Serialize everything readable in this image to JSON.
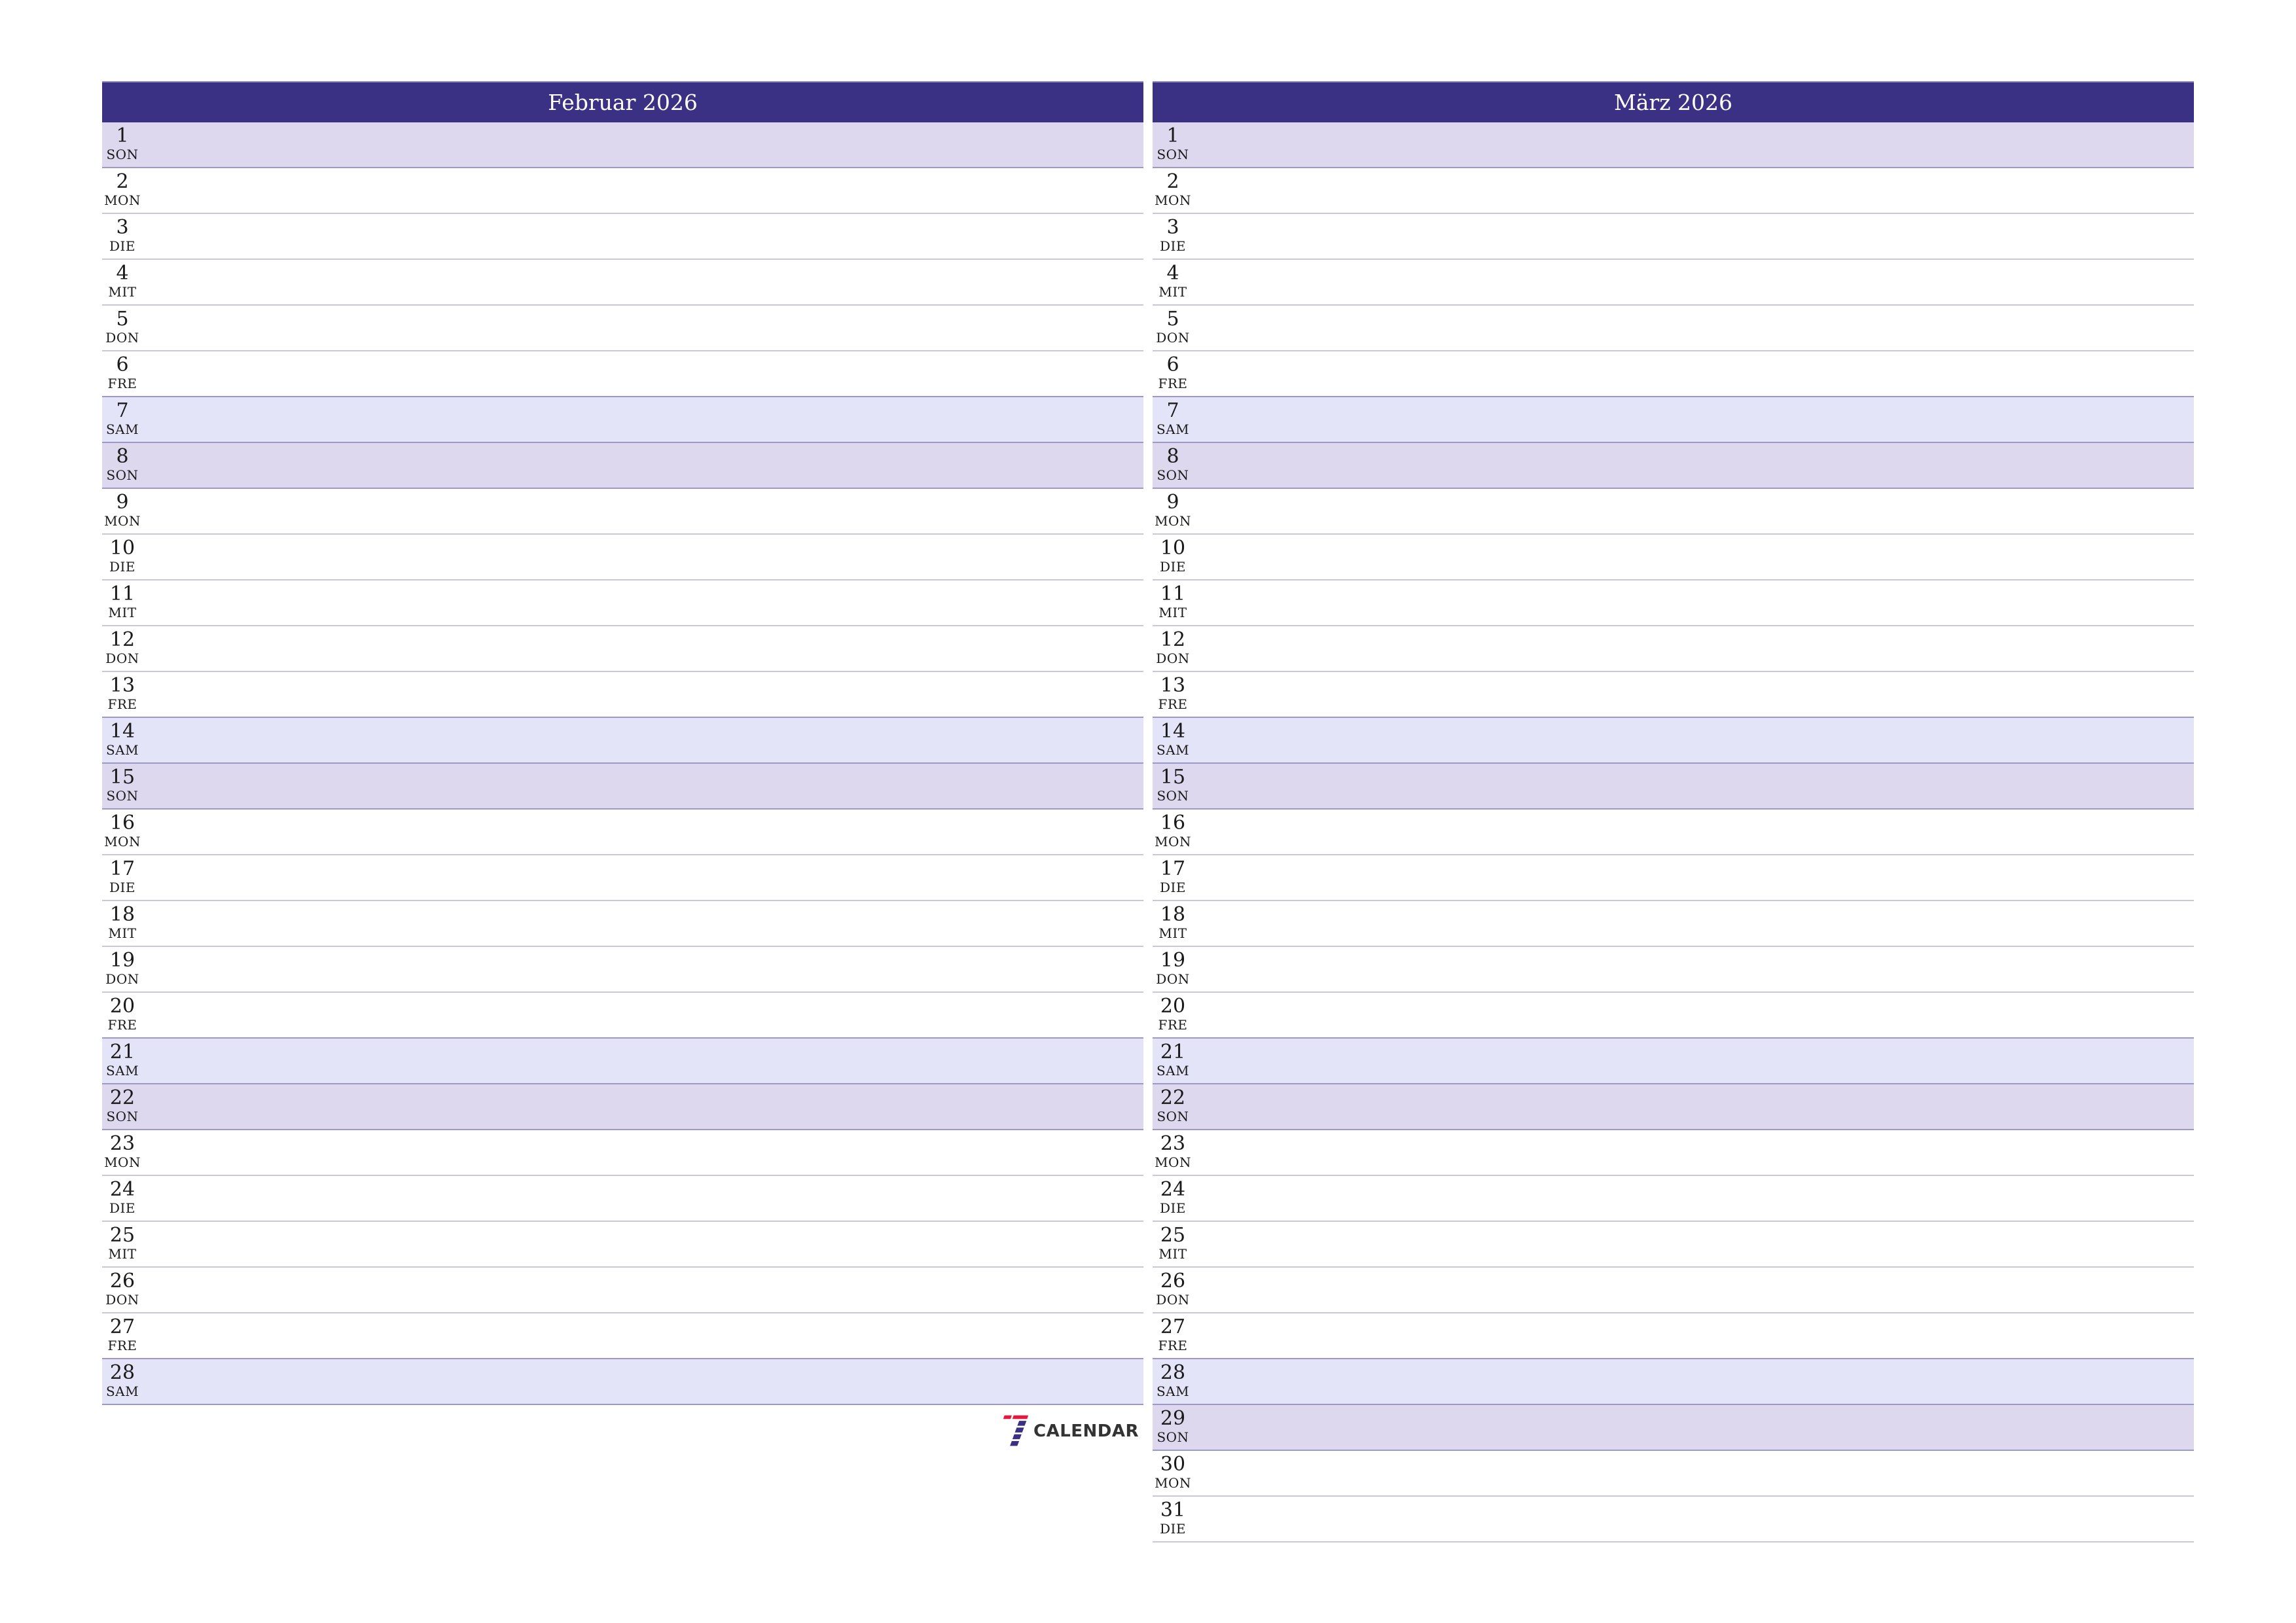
{
  "colors": {
    "header_bg": "#3a3185",
    "saturday_bg": "#e4e4f8",
    "sunday_bg": "#ddd8ee",
    "logo_red": "#e8173c",
    "logo_navy": "#3a3185"
  },
  "months": [
    {
      "title": "Februar 2026",
      "days": [
        {
          "num": "1",
          "name": "SON",
          "type": "sun"
        },
        {
          "num": "2",
          "name": "MON",
          "type": "weekday"
        },
        {
          "num": "3",
          "name": "DIE",
          "type": "weekday"
        },
        {
          "num": "4",
          "name": "MIT",
          "type": "weekday"
        },
        {
          "num": "5",
          "name": "DON",
          "type": "weekday"
        },
        {
          "num": "6",
          "name": "FRE",
          "type": "weekday"
        },
        {
          "num": "7",
          "name": "SAM",
          "type": "sat"
        },
        {
          "num": "8",
          "name": "SON",
          "type": "sun"
        },
        {
          "num": "9",
          "name": "MON",
          "type": "weekday"
        },
        {
          "num": "10",
          "name": "DIE",
          "type": "weekday"
        },
        {
          "num": "11",
          "name": "MIT",
          "type": "weekday"
        },
        {
          "num": "12",
          "name": "DON",
          "type": "weekday"
        },
        {
          "num": "13",
          "name": "FRE",
          "type": "weekday"
        },
        {
          "num": "14",
          "name": "SAM",
          "type": "sat"
        },
        {
          "num": "15",
          "name": "SON",
          "type": "sun"
        },
        {
          "num": "16",
          "name": "MON",
          "type": "weekday"
        },
        {
          "num": "17",
          "name": "DIE",
          "type": "weekday"
        },
        {
          "num": "18",
          "name": "MIT",
          "type": "weekday"
        },
        {
          "num": "19",
          "name": "DON",
          "type": "weekday"
        },
        {
          "num": "20",
          "name": "FRE",
          "type": "weekday"
        },
        {
          "num": "21",
          "name": "SAM",
          "type": "sat"
        },
        {
          "num": "22",
          "name": "SON",
          "type": "sun"
        },
        {
          "num": "23",
          "name": "MON",
          "type": "weekday"
        },
        {
          "num": "24",
          "name": "DIE",
          "type": "weekday"
        },
        {
          "num": "25",
          "name": "MIT",
          "type": "weekday"
        },
        {
          "num": "26",
          "name": "DON",
          "type": "weekday"
        },
        {
          "num": "27",
          "name": "FRE",
          "type": "weekday"
        },
        {
          "num": "28",
          "name": "SAM",
          "type": "sat"
        }
      ]
    },
    {
      "title": "März 2026",
      "days": [
        {
          "num": "1",
          "name": "SON",
          "type": "sun"
        },
        {
          "num": "2",
          "name": "MON",
          "type": "weekday"
        },
        {
          "num": "3",
          "name": "DIE",
          "type": "weekday"
        },
        {
          "num": "4",
          "name": "MIT",
          "type": "weekday"
        },
        {
          "num": "5",
          "name": "DON",
          "type": "weekday"
        },
        {
          "num": "6",
          "name": "FRE",
          "type": "weekday"
        },
        {
          "num": "7",
          "name": "SAM",
          "type": "sat"
        },
        {
          "num": "8",
          "name": "SON",
          "type": "sun"
        },
        {
          "num": "9",
          "name": "MON",
          "type": "weekday"
        },
        {
          "num": "10",
          "name": "DIE",
          "type": "weekday"
        },
        {
          "num": "11",
          "name": "MIT",
          "type": "weekday"
        },
        {
          "num": "12",
          "name": "DON",
          "type": "weekday"
        },
        {
          "num": "13",
          "name": "FRE",
          "type": "weekday"
        },
        {
          "num": "14",
          "name": "SAM",
          "type": "sat"
        },
        {
          "num": "15",
          "name": "SON",
          "type": "sun"
        },
        {
          "num": "16",
          "name": "MON",
          "type": "weekday"
        },
        {
          "num": "17",
          "name": "DIE",
          "type": "weekday"
        },
        {
          "num": "18",
          "name": "MIT",
          "type": "weekday"
        },
        {
          "num": "19",
          "name": "DON",
          "type": "weekday"
        },
        {
          "num": "20",
          "name": "FRE",
          "type": "weekday"
        },
        {
          "num": "21",
          "name": "SAM",
          "type": "sat"
        },
        {
          "num": "22",
          "name": "SON",
          "type": "sun"
        },
        {
          "num": "23",
          "name": "MON",
          "type": "weekday"
        },
        {
          "num": "24",
          "name": "DIE",
          "type": "weekday"
        },
        {
          "num": "25",
          "name": "MIT",
          "type": "weekday"
        },
        {
          "num": "26",
          "name": "DON",
          "type": "weekday"
        },
        {
          "num": "27",
          "name": "FRE",
          "type": "weekday"
        },
        {
          "num": "28",
          "name": "SAM",
          "type": "sat"
        },
        {
          "num": "29",
          "name": "SON",
          "type": "sun"
        },
        {
          "num": "30",
          "name": "MON",
          "type": "weekday"
        },
        {
          "num": "31",
          "name": "DIE",
          "type": "weekday"
        }
      ]
    }
  ],
  "logo": {
    "icon": "seven-stripes-logo-icon",
    "text": "CALENDAR"
  }
}
